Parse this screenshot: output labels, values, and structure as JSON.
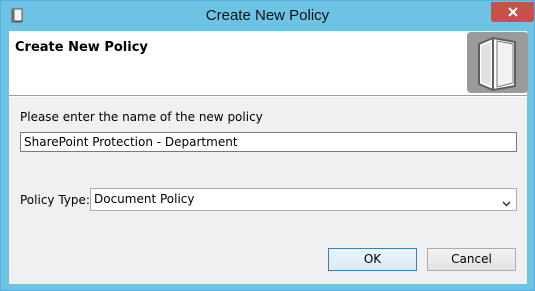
{
  "window": {
    "title": "Create New Policy"
  },
  "header": {
    "title": "Create New Policy",
    "icon": "book-icon"
  },
  "form": {
    "prompt": "Please enter the name of the new policy",
    "name_value": "SharePoint Protection - Department",
    "policy_type_label": "Policy Type:",
    "policy_type_value": "Document Policy"
  },
  "buttons": {
    "ok": "OK",
    "cancel": "Cancel"
  },
  "colors": {
    "frame": "#6cc3e4",
    "close": "#c7504a",
    "header_icon_bg": "#9a9a9a"
  }
}
